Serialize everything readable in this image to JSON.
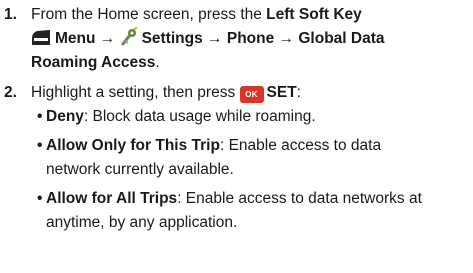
{
  "steps": [
    {
      "number": "1.",
      "lines": [
        {
          "pre": "From the Home screen, press the ",
          "bold": "Left Soft Key"
        },
        {
          "menu": "Menu",
          "arrow1": " → ",
          "settings": "Settings",
          "arrow2": " → ",
          "phone": "Phone",
          "arrow3": "  → ",
          "global": "Global Data"
        },
        {
          "bold": "Roaming Access",
          "post": "."
        }
      ]
    },
    {
      "number": "2.",
      "pre": "Highlight a setting, then press ",
      "ok_key": "OK",
      "bold": "SET",
      "post": ":",
      "options": [
        {
          "bullet": "•",
          "label": "Deny",
          "lines": [
            ": Block data usage while roaming."
          ]
        },
        {
          "bullet": "•",
          "label": "Allow Only for This Trip",
          "lines": [
            ": Enable access to data",
            "network currently available."
          ]
        },
        {
          "bullet": "•",
          "label": "Allow for All Trips",
          "lines": [
            ": Enable access to data networks at",
            "anytime, by any application."
          ]
        }
      ]
    }
  ],
  "icons": {
    "soft_key": "left-soft-key-icon",
    "settings": "settings-wrench-icon",
    "ok": "ok-key-icon"
  },
  "colors": {
    "text": "#1a1a1a",
    "ok_key": "#d8342c",
    "settings_icon": "#5c8a3a"
  }
}
